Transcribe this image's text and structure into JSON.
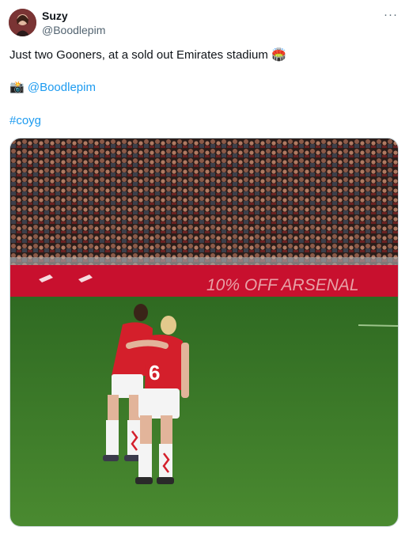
{
  "author": {
    "display_name": "Suzy",
    "handle": "@Boodlepim",
    "avatar_icon": "avatar-photo"
  },
  "menu": {
    "more_label": "···",
    "icon": "more-horizontal-icon"
  },
  "tweet": {
    "text": "Just two Gooners, at a sold out Emirates stadium",
    "text_emoji": "🏟️",
    "credit_emoji": "📸",
    "credit_mention": "@Boodlepim",
    "hashtag": "#coyg"
  },
  "media": {
    "banner_text": "10% OFF ARSENAL",
    "player_number": "6",
    "colors": {
      "pitch": "#3d7a2a",
      "banner": "#c8102e",
      "kit_red": "#d41f2b",
      "kit_white": "#f4f4f4",
      "link": "#1d9bf0"
    }
  }
}
